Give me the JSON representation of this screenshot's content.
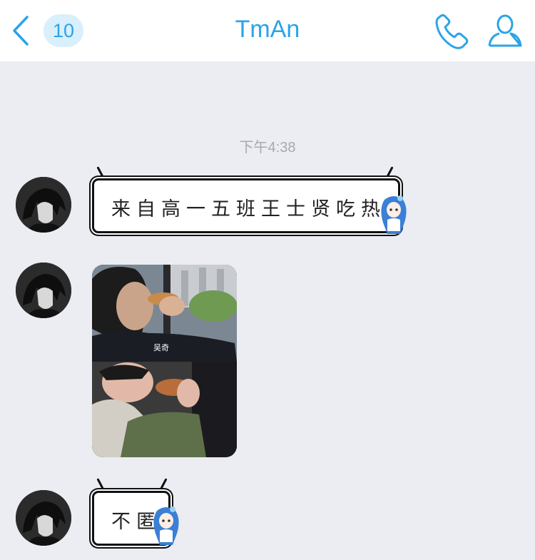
{
  "nav": {
    "back_icon": "chevron-left-icon",
    "unread_count": "10",
    "title": "TmAn",
    "phone_icon": "phone-icon",
    "profile_icon": "person-icon",
    "accent": "#2aa4e6"
  },
  "chat": {
    "timestamp": "下午4:38",
    "messages": [
      {
        "type": "text",
        "text": "来自高一五班王士贤吃热狗"
      },
      {
        "type": "image",
        "caption": "吴奇"
      },
      {
        "type": "text",
        "text": "不匿"
      }
    ]
  }
}
